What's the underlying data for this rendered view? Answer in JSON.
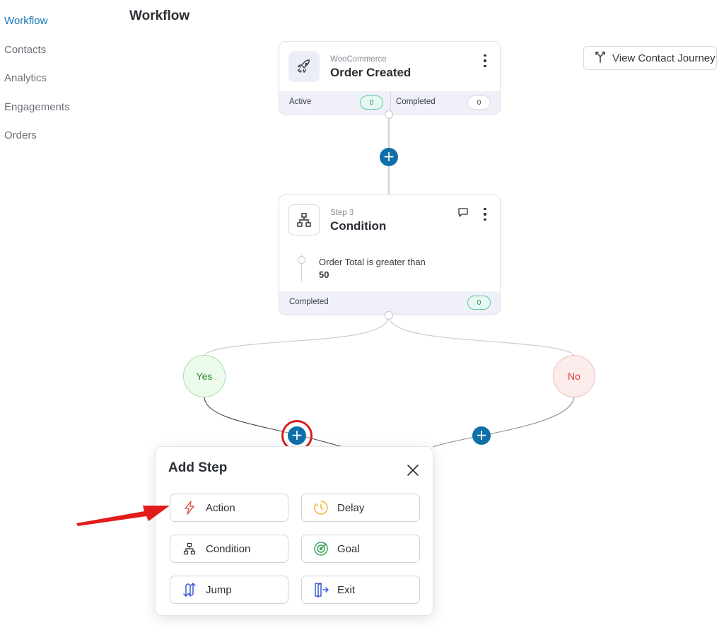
{
  "nav": {
    "items": [
      {
        "label": "Workflow",
        "active": true
      },
      {
        "label": "Contacts",
        "active": false
      },
      {
        "label": "Analytics",
        "active": false
      },
      {
        "label": "Engagements",
        "active": false
      },
      {
        "label": "Orders",
        "active": false
      }
    ]
  },
  "page": {
    "title": "Workflow"
  },
  "toolbar": {
    "view_contact_journey": "View Contact Journey"
  },
  "trigger_card": {
    "source": "WooCommerce",
    "title": "Order Created",
    "icon": "rocket-icon",
    "active_label": "Active",
    "active_count": "0",
    "completed_label": "Completed",
    "completed_count": "0"
  },
  "condition_card": {
    "step": "Step 3",
    "title": "Condition",
    "icon": "condition-icon",
    "rule_text": "Order Total is greater than",
    "rule_value": "50",
    "completed_label": "Completed",
    "completed_count": "0"
  },
  "branches": {
    "yes": "Yes",
    "no": "No"
  },
  "add_step": {
    "title": "Add Step",
    "options": [
      {
        "label": "Action",
        "icon": "lightning-icon"
      },
      {
        "label": "Delay",
        "icon": "clock-icon"
      },
      {
        "label": "Condition",
        "icon": "condition-icon"
      },
      {
        "label": "Goal",
        "icon": "target-icon"
      },
      {
        "label": "Jump",
        "icon": "jump-icon"
      },
      {
        "label": "Exit",
        "icon": "exit-icon"
      }
    ]
  },
  "colors": {
    "accent": "#1676b8",
    "plus": "#0f6fa8",
    "highlight": "#d42020",
    "yes": "#2b8a2e",
    "no": "#d23e34"
  }
}
